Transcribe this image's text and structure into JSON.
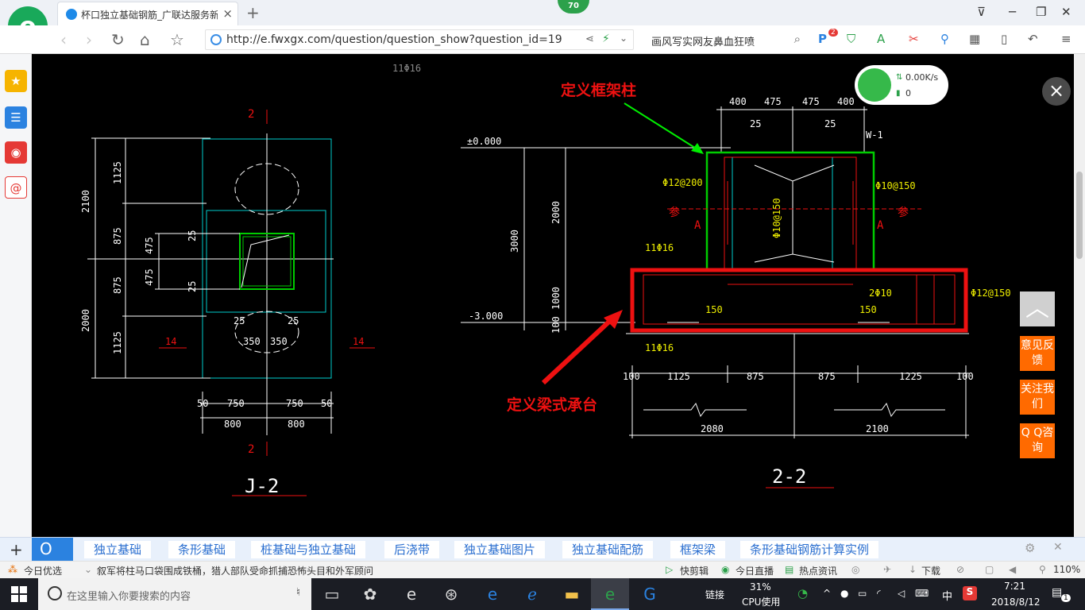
{
  "browser": {
    "tab_title": "杯口独立基础钢筋_广联达服务新",
    "tab_close": "×",
    "new_tab": "+",
    "notification_badge": "70",
    "url": "http://e.fwxgx.com/question/question_show?question_id=19",
    "search_text": "画风写实网友鼻血狂喷",
    "extension_badge": "2"
  },
  "window_controls": {
    "menu": "⊽",
    "minimize": "─",
    "maximize": "❐",
    "close": "✕"
  },
  "net_widget": {
    "speed": "0.00K/s",
    "count": "0"
  },
  "close_overlay": "×",
  "side_buttons": {
    "back_top": "︿",
    "feedback": "意见反馈",
    "follow": "关注我们",
    "qq": "Q Q咨询"
  },
  "drawing": {
    "left_view": {
      "title": "J-2",
      "section_mark": "2",
      "axis_mark": "14",
      "dims_vertical": [
        "2100",
        "1125",
        "875",
        "475",
        "475",
        "875",
        "1125",
        "2000",
        "25",
        "25"
      ],
      "dims_horizontal": [
        "50",
        "750",
        "750",
        "50",
        "800",
        "800",
        "350",
        "350",
        "25",
        "25"
      ]
    },
    "right_view": {
      "title": "2-2",
      "elev_top": "±0.000",
      "elev_bottom": "-3.000",
      "dims_top": [
        "400",
        "475",
        "475",
        "400",
        "25",
        "25"
      ],
      "dims_vertical": [
        "2000",
        "3000",
        "1000",
        "100"
      ],
      "dims_bottom": [
        "100",
        "1125",
        "875",
        "875",
        "1225",
        "100",
        "2080",
        "2100"
      ],
      "rebar": [
        "Φ12@200",
        "Φ10@150",
        "11Φ16",
        "11Φ16",
        "2Φ10",
        "Φ12@150",
        "Φ10@150"
      ],
      "labels": [
        "W-1",
        "参",
        "A",
        "参",
        "A",
        "150",
        "150"
      ],
      "top_label": "11Φ16"
    },
    "annotations": {
      "column": "定义框架柱",
      "cap_beam": "定义梁式承台",
      "column_color": "#00e000",
      "cap_color": "#ff0000"
    }
  },
  "related_links": [
    "独立基础",
    "条形基础",
    "桩基础与独立基础",
    "后浇带",
    "独立基础图片",
    "独立基础配筋",
    "框架梁",
    "条形基础钢筋计算实例"
  ],
  "statusbar": {
    "today": "今日优选",
    "news": "叙军将柱马口袋围成铁桶，猎人部队受命抓捕恐怖头目和外军顾问",
    "items": [
      "快剪辑",
      "今日直播",
      "热点资讯",
      "下载"
    ],
    "zoom": "110%"
  },
  "taskbar": {
    "search_placeholder": "在这里输入你要搜索的内容",
    "link_label": "链接",
    "cpu_percent": "31%",
    "cpu_label": "CPU使用",
    "ime": "中",
    "time": "7:21",
    "date": "2018/8/12",
    "notif_count": "1"
  }
}
